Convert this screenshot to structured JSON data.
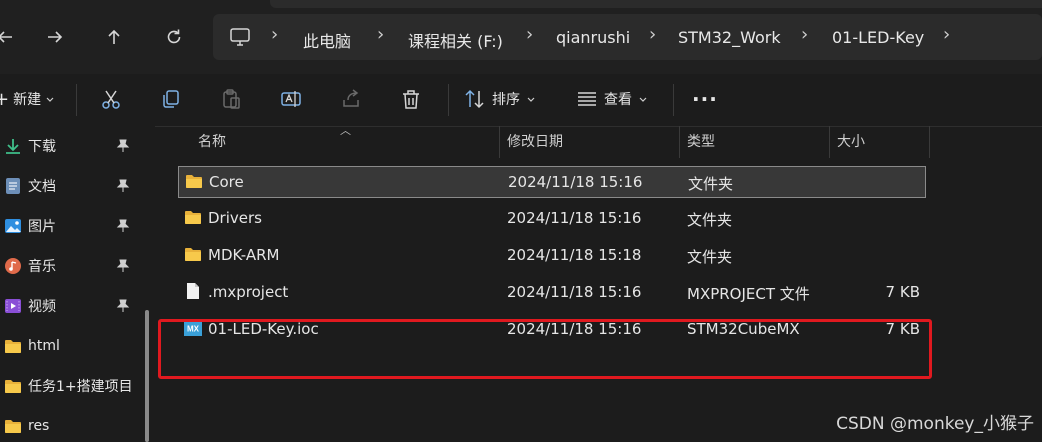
{
  "nav": {
    "back_icon": "back-arrow-icon",
    "forward_icon": "forward-arrow-icon",
    "up_icon": "up-arrow-icon",
    "refresh_icon": "refresh-icon"
  },
  "address": {
    "root_icon": "computer-icon",
    "crumbs": [
      "此电脑",
      "课程相关 (F:)",
      "qianrushi",
      "STM32_Work",
      "01-LED-Key"
    ]
  },
  "toolbar": {
    "new_label": "新建",
    "sort_label": "排序",
    "view_label": "查看",
    "more_label": "···"
  },
  "sidebar": {
    "items": [
      {
        "label": "下载",
        "icon": "download-icon",
        "pinned": true
      },
      {
        "label": "文档",
        "icon": "document-icon",
        "pinned": true
      },
      {
        "label": "图片",
        "icon": "picture-icon",
        "pinned": true
      },
      {
        "label": "音乐",
        "icon": "music-icon",
        "pinned": true
      },
      {
        "label": "视频",
        "icon": "video-icon",
        "pinned": true
      },
      {
        "label": "html",
        "icon": "folder-icon",
        "pinned": false
      },
      {
        "label": "任务1+搭建项目",
        "icon": "folder-icon",
        "pinned": false
      },
      {
        "label": "res",
        "icon": "folder-icon",
        "pinned": false
      }
    ]
  },
  "columns": {
    "name": "名称",
    "modified": "修改日期",
    "type": "类型",
    "size": "大小"
  },
  "files": [
    {
      "name": "Core",
      "modified": "2024/11/18 15:16",
      "type": "文件夹",
      "size": "",
      "icon": "folder-icon",
      "selected": true
    },
    {
      "name": "Drivers",
      "modified": "2024/11/18 15:16",
      "type": "文件夹",
      "size": "",
      "icon": "folder-icon",
      "selected": false
    },
    {
      "name": "MDK-ARM",
      "modified": "2024/11/18 15:18",
      "type": "文件夹",
      "size": "",
      "icon": "folder-icon",
      "selected": false
    },
    {
      "name": ".mxproject",
      "modified": "2024/11/18 15:16",
      "type": "MXPROJECT 文件",
      "size": "7 KB",
      "icon": "file-icon",
      "selected": false
    },
    {
      "name": "01-LED-Key.ioc",
      "modified": "2024/11/18 15:16",
      "type": "STM32CubeMX",
      "size": "7 KB",
      "icon": "stm32cubemx-icon",
      "mx_badge": "MX",
      "selected": false
    }
  ],
  "annotation_color": "#e0191f",
  "watermark": "CSDN @monkey_小猴子"
}
